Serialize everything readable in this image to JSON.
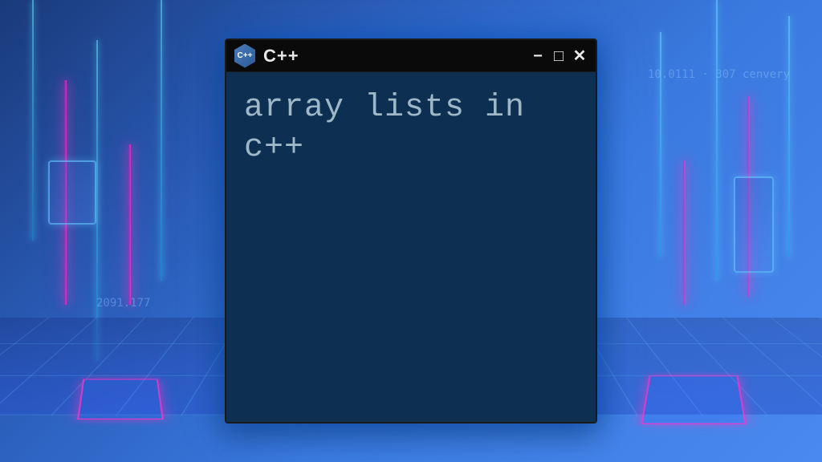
{
  "window": {
    "title": "C++",
    "icon_label": "C++"
  },
  "terminal": {
    "content": "array lists in c++"
  },
  "background": {
    "text1": "2091.177",
    "text2": "10.0111 · 307  cenvery"
  }
}
